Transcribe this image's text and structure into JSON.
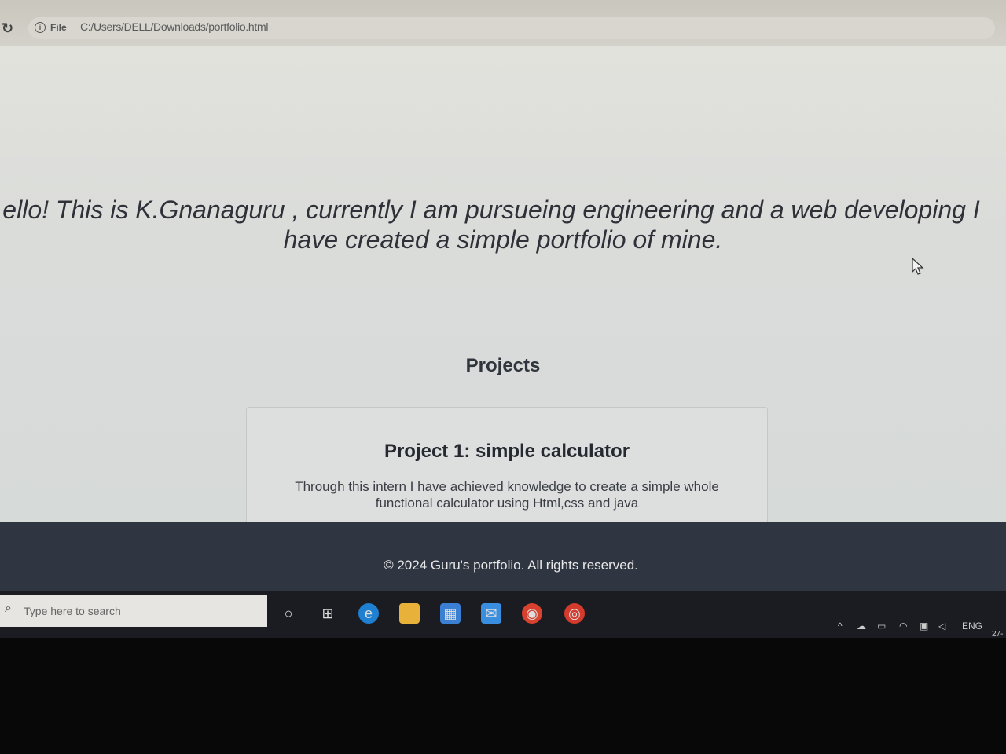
{
  "browser": {
    "chip_label": "File",
    "url": "C:/Users/DELL/Downloads/portfolio.html"
  },
  "page": {
    "intro_line1": "ello! This is K.Gnanaguru , currently I am pursueing engineering and a web developing I",
    "intro_line2": "have created a simple portfolio of mine.",
    "projects_heading": "Projects",
    "project": {
      "title": "Project 1: simple calculator",
      "description": "Through this intern I have achieved knowledge to create a simple whole functional calculator using Html,css and java"
    },
    "footer": "© 2024 Guru's portfolio. All rights reserved."
  },
  "taskbar": {
    "search_placeholder": "Type here to search",
    "language": "ENG",
    "clock_partial": "27-"
  },
  "colors": {
    "footer_bg": "#2f3642",
    "page_bg": "#dcdedc",
    "text": "#2e3138"
  }
}
